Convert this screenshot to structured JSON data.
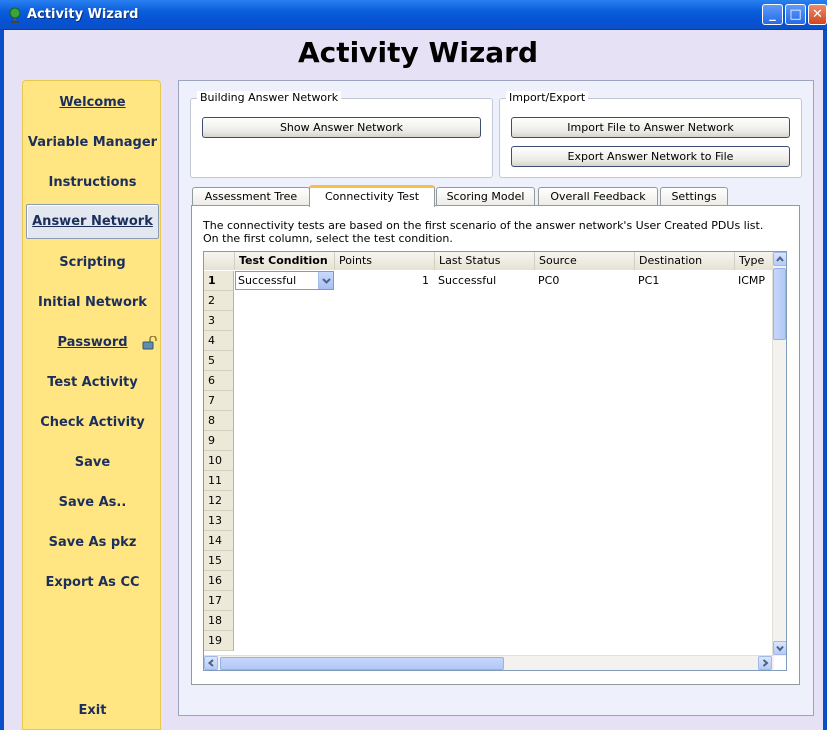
{
  "window": {
    "title": "Activity Wizard",
    "controls": {
      "minimize": "_",
      "maximize": "□",
      "close": "✕"
    }
  },
  "main_title": "Activity Wizard",
  "nav": {
    "items": [
      {
        "label": "Welcome",
        "active": false
      },
      {
        "label": "Variable Manager",
        "active": false
      },
      {
        "label": "Instructions",
        "active": false
      },
      {
        "label": "Answer Network",
        "active": true
      },
      {
        "label": "Scripting",
        "active": false
      },
      {
        "label": "Initial Network",
        "active": false
      },
      {
        "label": "Password",
        "active": false,
        "icon": "unlock-icon"
      },
      {
        "label": "Test Activity",
        "active": false
      },
      {
        "label": "Check Activity",
        "active": false
      },
      {
        "label": "Save",
        "active": false
      },
      {
        "label": "Save As..",
        "active": false
      },
      {
        "label": "Save As pkz",
        "active": false
      },
      {
        "label": "Export As CC",
        "active": false
      },
      {
        "label": "Exit",
        "active": false
      }
    ]
  },
  "building_group": {
    "label": "Building Answer Network",
    "show_button": "Show Answer Network"
  },
  "import_group": {
    "label": "Import/Export",
    "import_button": "Import File to Answer Network",
    "export_button": "Export Answer Network to File"
  },
  "tabs": [
    {
      "label": "Assessment Tree",
      "active": false
    },
    {
      "label": "Connectivity Test",
      "active": true
    },
    {
      "label": "Scoring Model",
      "active": false
    },
    {
      "label": "Overall Feedback",
      "active": false
    },
    {
      "label": "Settings",
      "active": false
    }
  ],
  "connectivity": {
    "description_line1": "The connectivity tests are based on the first scenario of the answer network's User Created PDUs list.",
    "description_line2": "On the first column, select the test condition.",
    "columns": [
      "Test Condition",
      "Points",
      "Last Status",
      "Source",
      "Destination",
      "Type"
    ],
    "rows": [
      {
        "num": "1",
        "test_condition": "Successful",
        "points": "1",
        "last_status": "Successful",
        "source": "PC0",
        "destination": "PC1",
        "type": "ICMP"
      }
    ],
    "row_numbers": [
      "1",
      "2",
      "3",
      "4",
      "5",
      "6",
      "7",
      "8",
      "9",
      "10",
      "11",
      "12",
      "13",
      "14",
      "15",
      "16",
      "17",
      "18",
      "19"
    ]
  },
  "colors": {
    "titlebar": "#0a5ddb",
    "nav_background": "#ffe682",
    "content_background": "#eef0fb",
    "active_tab_accent": "#f5c04a"
  }
}
